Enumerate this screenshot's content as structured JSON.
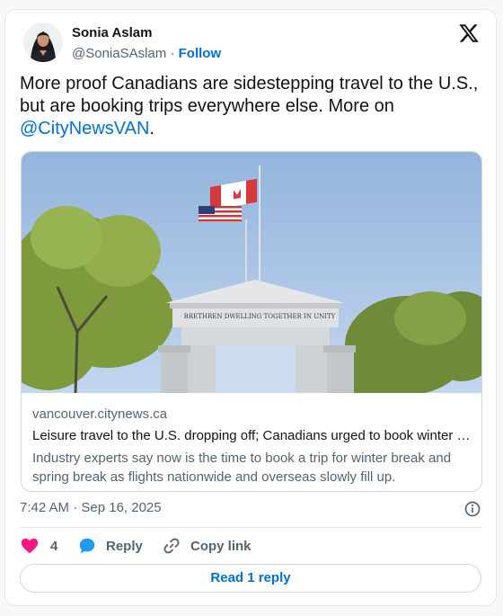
{
  "author": {
    "name": "Sonia Aslam",
    "handle": "@SoniaSAslam",
    "separator": "·",
    "follow_label": "Follow"
  },
  "tweet": {
    "text_before": "More proof Canadians are sidestepping travel to the U.S., but are booking trips everywhere else. More on ",
    "mention": "@CityNewsVAN",
    "text_after": "."
  },
  "link_card": {
    "domain": "vancouver.citynews.ca",
    "title": "Leisure travel to the U.S. dropping off; Canadians urged to book winter …",
    "description": "Industry experts say now is the time to book a trip for winter break and spring break as flights nationwide and overseas slowly fill up.",
    "image_inscription": "BRETHREN DWELLING TOGETHER IN UNITY"
  },
  "meta": {
    "timestamp": "7:42 AM · Sep 16, 2025"
  },
  "actions": {
    "like_count": "4",
    "reply_label": "Reply",
    "copy_link_label": "Copy link",
    "read_replies_label": "Read 1 reply"
  },
  "colors": {
    "link_blue": "#006fd6",
    "like_pink": "#f91880",
    "reply_blue": "#1d9bf0",
    "muted_text": "#536471"
  }
}
